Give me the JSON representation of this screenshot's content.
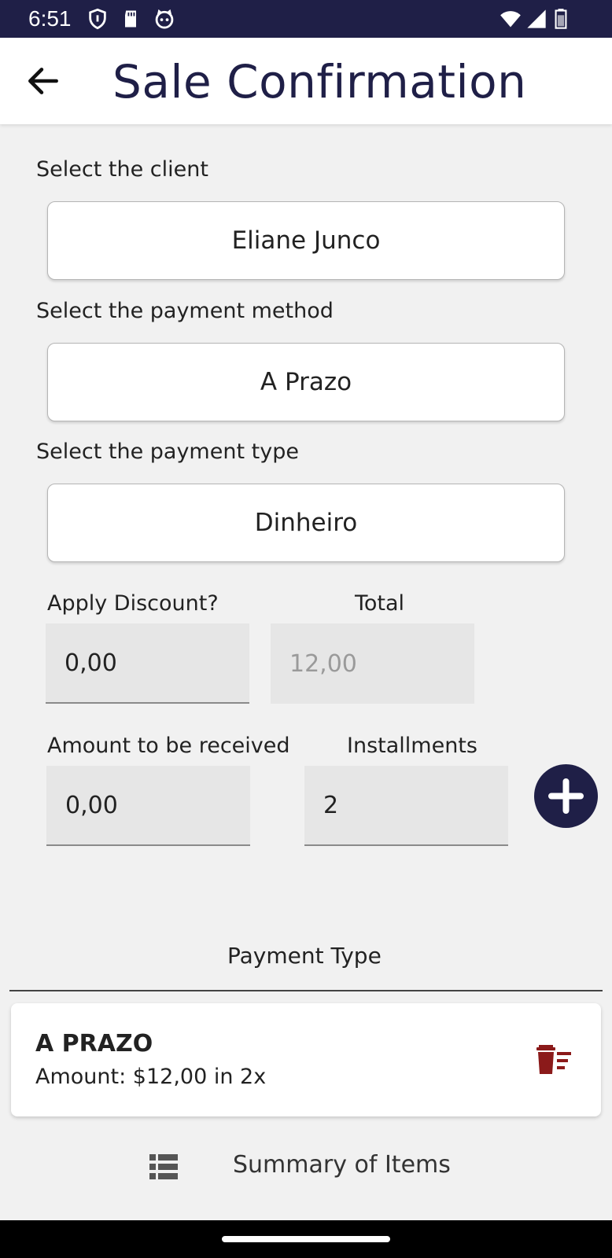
{
  "status_bar": {
    "time": "6:51"
  },
  "app_bar": {
    "title": "Sale Confirmation"
  },
  "client": {
    "label": "Select the client",
    "value": "Eliane Junco"
  },
  "payment_method": {
    "label": "Select the payment method",
    "value": "A Prazo"
  },
  "payment_type_select": {
    "label": "Select the payment type",
    "value": "Dinheiro"
  },
  "discount": {
    "label": "Apply Discount?",
    "value": "0,00"
  },
  "total": {
    "label": "Total",
    "value": "12,00"
  },
  "amount_received": {
    "label": "Amount to be received",
    "value": "0,00"
  },
  "installments": {
    "label": "Installments",
    "value": "2"
  },
  "payment_list": {
    "header": "Payment Type",
    "items": [
      {
        "title": "A PRAZO",
        "amount": "Amount: $12,00 in 2x"
      }
    ]
  },
  "summary": {
    "label": "Summary of Items"
  },
  "colors": {
    "primary": "#1f1f47",
    "danger": "#8b1a1a",
    "background": "#f1f1f1"
  }
}
